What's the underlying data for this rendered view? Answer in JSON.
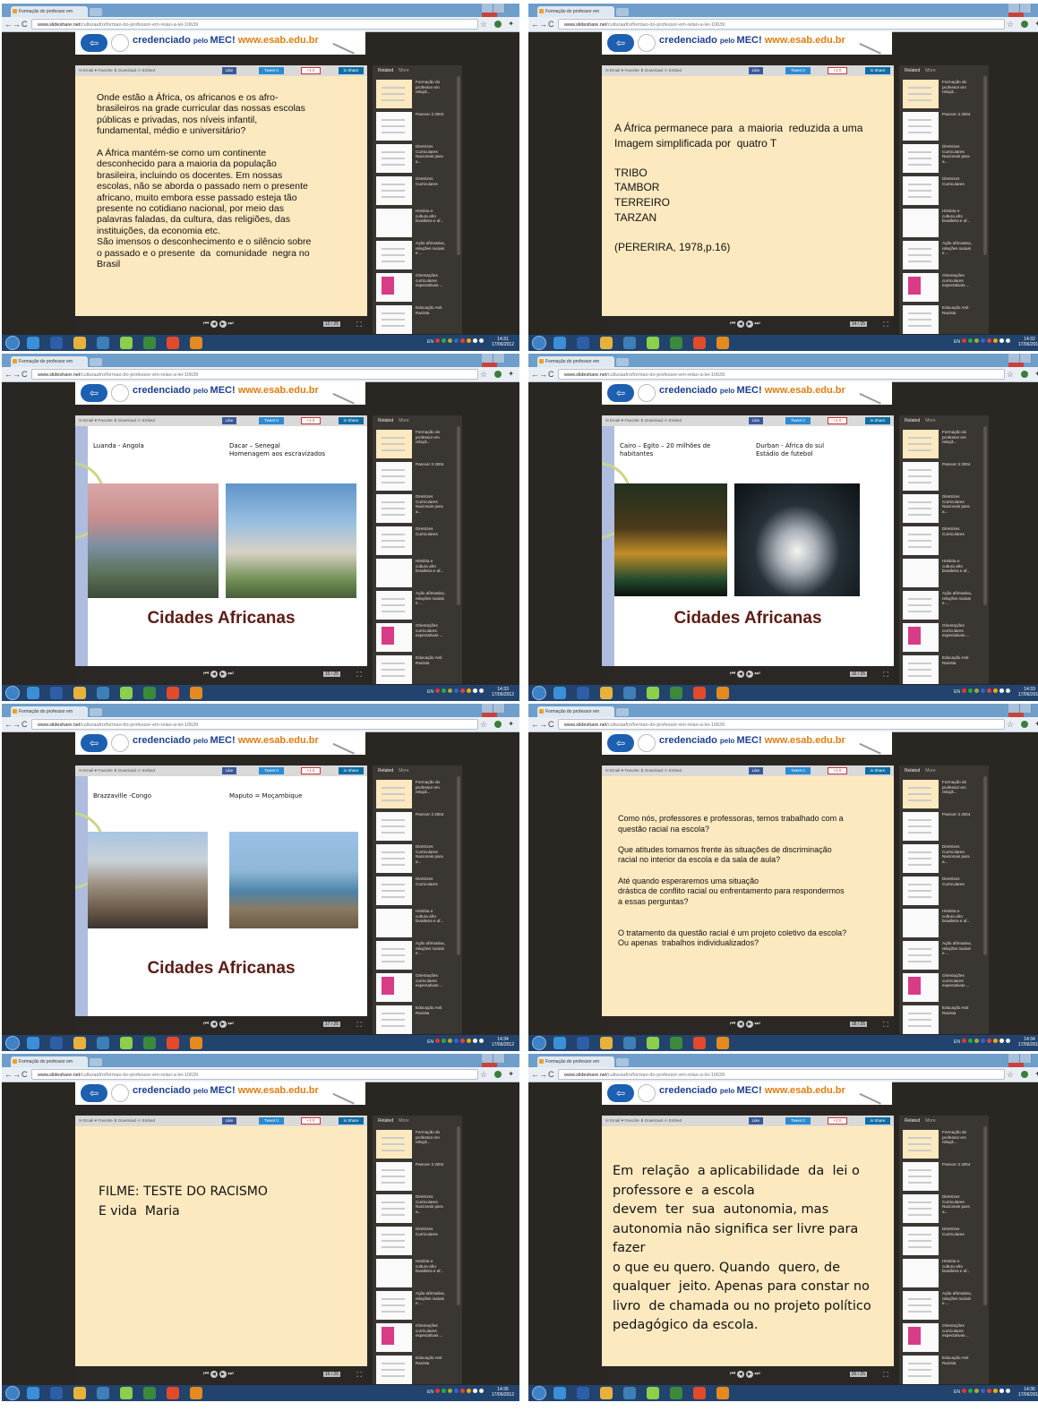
{
  "colors": {
    "slide_text_bg": "#fde9bf",
    "title_red": "#5b1d16",
    "chrome_blue": "#6e9ec9",
    "player_dark": "#2a2622",
    "banner_blue": "#1b3f8f",
    "banner_orange": "#e07d10"
  },
  "browser": {
    "tab_title": "Formação do professor em",
    "url_host": "www.slideshare.net",
    "url_path": "/culturaafro/formao-do-professor-em-relao-a-lei-10639",
    "back_icon": "arrow-left-icon",
    "forward_icon": "arrow-right-icon",
    "reload_icon": "reload-icon",
    "star_icon": "star-icon",
    "wrench_icon": "wrench-icon"
  },
  "banner": {
    "text": "credenciado",
    "text_small": "pelo",
    "text_mec": "MEC!",
    "url": "www.esab.edu.br"
  },
  "toolbar": {
    "left": "✉ Email   ♥ Favorite   ⬇ Download   ‹/› Embed",
    "like": "Like",
    "tweet": "Tweet  0",
    "gplus": "+1  0",
    "share": "in Share"
  },
  "sidebar": {
    "tabs": [
      "Related",
      "More"
    ],
    "items": [
      "Formação do\nprofessor em\nrelaçã...",
      "Parecer 3 2004",
      "Diretrizes\nCurriculares\nNacionais para\na...",
      "Diretrizes\nCurriculares",
      "História e\ncultura afro\nbrasileira e af...",
      "Ação afirmativa,\nrelações raciais\ne ...",
      "Orientações\ncurriculares\nexpectativas ...",
      "Educação Anti\nRacista"
    ]
  },
  "screens": [
    {
      "kind": "text",
      "page": "12 / 25",
      "clock_time": "14:31",
      "clock_date": "17/06/2012",
      "body": "Onde estão a África, os africanos e os afro-\nbrasileiros na grade curricular das nossas escolas\npúblicas e privadas, nos níveis infantil,\nfundamental, médio e universitário?\n\nA África mantém-se como um continente\ndesconhecido para a maioria da população\nbrasileira, incluindo os docentes. Em nossas\nescolas, não se aborda o passado nem o presente\nafricano, muito embora esse passado esteja tão\npresente no cotidiano nacional, por meio das\npalavras faladas, da cultura, das religiões, das\ninstituições, da economia etc.\nSão imensos o desconhecimento e o silêncio sobre\no passado e o presente  da  comunidade  negra no\nBrasil"
    },
    {
      "kind": "text",
      "page": "14 / 25",
      "clock_time": "14:32",
      "clock_date": "17/06/2012",
      "body": "A África permanece para  a maioria  reduzida a uma\nImagem simplificada por  quatro T\n\nTRIBO\nTAMBOR\nTERREIRO\nTARZAN\n\n(PERERIRA, 1978,p.16)"
    },
    {
      "kind": "photo",
      "page": "15 / 25",
      "clock_time": "14:33",
      "clock_date": "17/06/2012",
      "caption_left": "Luanda - Angola",
      "caption_right": "Dacar – Senegal\nHomenagem aos escravizados",
      "title": "Cidades Africanas"
    },
    {
      "kind": "photo",
      "page": "16 / 25",
      "clock_time": "14:33",
      "clock_date": "17/06/2012",
      "caption_left": "Cairo – Egito – 20 milhões de\nhabitantes",
      "caption_right": "Durban - África do sul\nEstádio de futebol",
      "title": "Cidades Africanas"
    },
    {
      "kind": "photo",
      "page": "17 / 25",
      "clock_time": "14:34",
      "clock_date": "17/06/2012",
      "caption_left": "Brazzaville -Congo",
      "caption_right": "Maputo = Moçambique",
      "title": "Cidades Africanas"
    },
    {
      "kind": "text",
      "page": "18 / 25",
      "clock_time": "14:34",
      "clock_date": "17/06/2012",
      "body": "Como nós, professores e professoras, temos trabalhado com a\nquestão racial na escola?\n\nQue atitudes tomamos frente às situações de discriminação\nracial no interior da escola e da sala de aula?\n\nAté quando esperaremos uma situação\ndrástica de conflito racial ou enfrentamento para respondermos\na essas perguntas?\n\n\nO tratamento da questão racial é um projeto coletivo da escola?\nOu apenas  trabalhos individualizados?"
    },
    {
      "kind": "text",
      "page": "19 / 25",
      "clock_time": "14:35",
      "clock_date": "17/06/2012",
      "body": "FILME: TESTE DO RACISMO\nE vida  Maria"
    },
    {
      "kind": "text",
      "page": "20 / 25",
      "clock_time": "14:36",
      "clock_date": "17/06/2012",
      "body": "Em  relação  a aplicabilidade  da  lei o\nprofessore e  a escola\ndevem  ter  sua  autonomia, mas\nautonomia não significa ser livre para fazer\no que eu quero. Quando  quero, de\nqualquer  jeito. Apenas para constar no\nlivro  de chamada ou no projeto político\npedagógico da escola."
    }
  ]
}
